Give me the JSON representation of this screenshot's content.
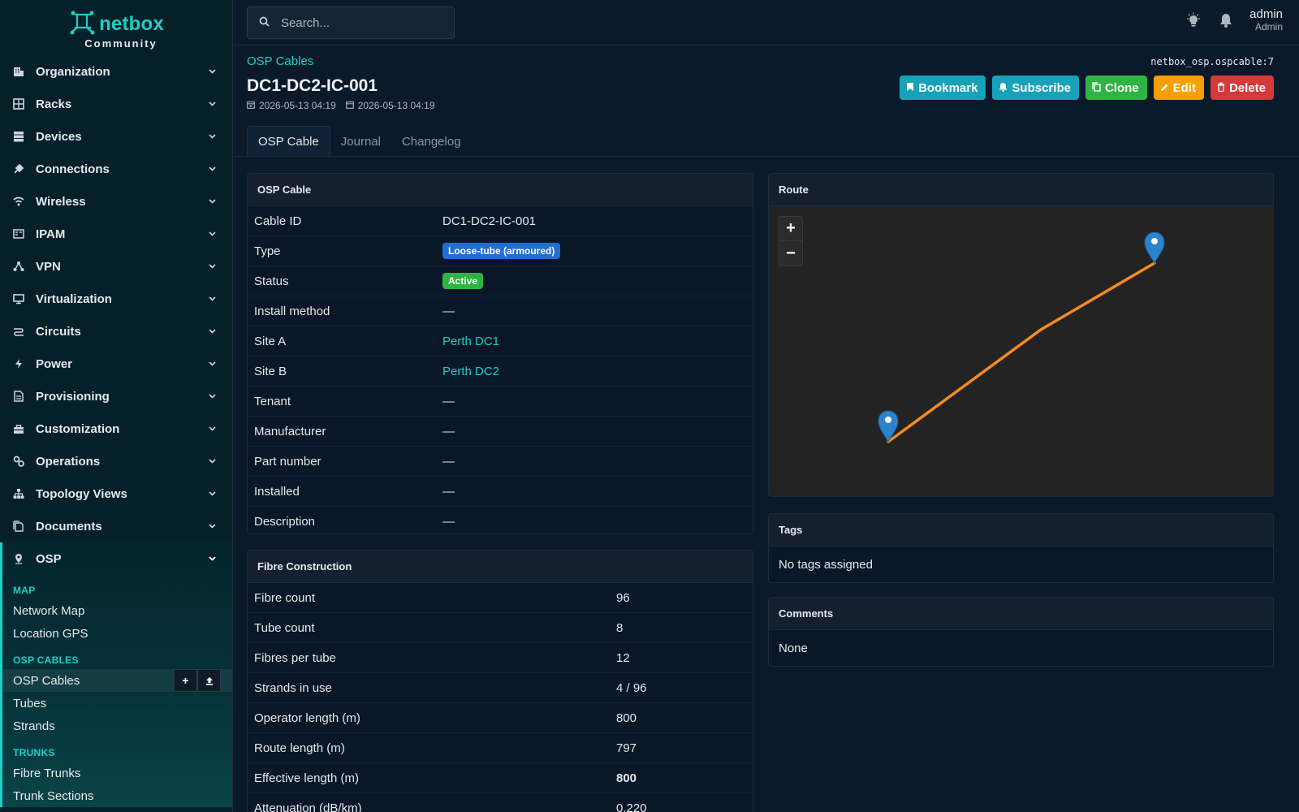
{
  "brand": {
    "name": "netbox",
    "sub": "Community"
  },
  "sidebar": {
    "items": [
      {
        "label": "Organization",
        "icon": "building-icon"
      },
      {
        "label": "Racks",
        "icon": "rack-icon"
      },
      {
        "label": "Devices",
        "icon": "server-icon"
      },
      {
        "label": "Connections",
        "icon": "plug-icon"
      },
      {
        "label": "Wireless",
        "icon": "wifi-icon"
      },
      {
        "label": "IPAM",
        "icon": "ip-icon"
      },
      {
        "label": "VPN",
        "icon": "network-icon"
      },
      {
        "label": "Virtualization",
        "icon": "monitor-icon"
      },
      {
        "label": "Circuits",
        "icon": "circuit-icon"
      },
      {
        "label": "Power",
        "icon": "lightning-icon"
      },
      {
        "label": "Provisioning",
        "icon": "file-icon"
      },
      {
        "label": "Customization",
        "icon": "toolbox-icon"
      },
      {
        "label": "Operations",
        "icon": "cogs-icon"
      },
      {
        "label": "Topology Views",
        "icon": "sitemap-icon"
      },
      {
        "label": "Documents",
        "icon": "documents-icon"
      },
      {
        "label": "OSP",
        "icon": "pin-icon"
      }
    ],
    "osp": {
      "sections": [
        {
          "title": "MAP",
          "items": [
            "Network Map",
            "Location GPS"
          ]
        },
        {
          "title": "OSP CABLES",
          "items": [
            "OSP Cables",
            "Tubes",
            "Strands"
          ]
        },
        {
          "title": "TRUNKS",
          "items": [
            "Fibre Trunks",
            "Trunk Sections"
          ]
        }
      ],
      "active": "OSP Cables"
    }
  },
  "search": {
    "placeholder": "Search..."
  },
  "user": {
    "name": "admin",
    "role": "Admin"
  },
  "page": {
    "breadcrumb": "OSP Cables",
    "objref": "netbox_osp.ospcable:7",
    "title": "DC1-DC2-IC-001",
    "created": "2026-05-13 04:19",
    "updated": "2026-05-13 04:19"
  },
  "actions": {
    "bookmark": "Bookmark",
    "subscribe": "Subscribe",
    "clone": "Clone",
    "edit": "Edit",
    "delete": "Delete"
  },
  "tabs": [
    "OSP Cable",
    "Journal",
    "Changelog"
  ],
  "cable": {
    "header": "OSP Cable",
    "rows": [
      {
        "k": "Cable ID",
        "v": "DC1-DC2-IC-001"
      },
      {
        "k": "Type",
        "v": "Loose-tube (armoured)"
      },
      {
        "k": "Status",
        "v": "Active"
      },
      {
        "k": "Install method",
        "v": "—"
      },
      {
        "k": "Site A",
        "v": "Perth DC1"
      },
      {
        "k": "Site B",
        "v": "Perth DC2"
      },
      {
        "k": "Tenant",
        "v": "—"
      },
      {
        "k": "Manufacturer",
        "v": "—"
      },
      {
        "k": "Part number",
        "v": "—"
      },
      {
        "k": "Installed",
        "v": "—"
      },
      {
        "k": "Description",
        "v": "—"
      }
    ]
  },
  "fibre": {
    "header": "Fibre Construction",
    "rows": [
      {
        "k": "Fibre count",
        "v": "96"
      },
      {
        "k": "Tube count",
        "v": "8"
      },
      {
        "k": "Fibres per tube",
        "v": "12"
      },
      {
        "k": "Strands in use",
        "v": "4 / 96"
      },
      {
        "k": "Operator length (m)",
        "v": "800"
      },
      {
        "k": "Route length (m)",
        "v": "797"
      },
      {
        "k": "Effective length (m)",
        "v": "800"
      },
      {
        "k": "Attenuation (dB/km)",
        "v": "0.220"
      }
    ]
  },
  "route": {
    "header": "Route",
    "zoom_in": "+",
    "zoom_out": "−",
    "line_color": "#f68b1f",
    "marker_color": "#2b83cb"
  },
  "tags": {
    "header": "Tags",
    "text": "No tags assigned"
  },
  "comments": {
    "header": "Comments",
    "text": "None"
  },
  "colors": {
    "accent": "#19d1c4",
    "bg": "#0b1a2b"
  }
}
